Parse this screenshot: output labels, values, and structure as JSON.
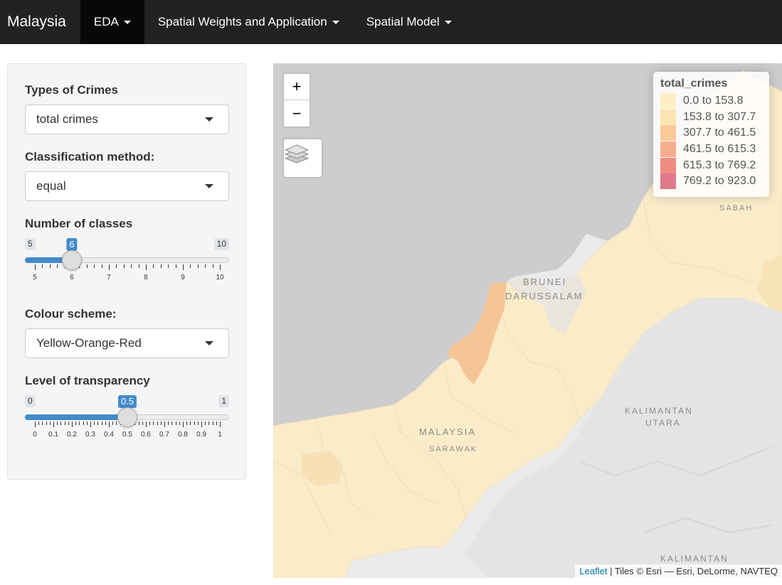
{
  "navbar": {
    "brand": "Malaysia",
    "items": [
      {
        "label": "EDA",
        "active": true
      },
      {
        "label": "Spatial Weights and Application",
        "active": false
      },
      {
        "label": "Spatial Model",
        "active": false
      }
    ]
  },
  "sidebar": {
    "crime_type": {
      "label": "Types of Crimes",
      "value": "total crimes"
    },
    "classification": {
      "label": "Classification method:",
      "value": "equal"
    },
    "num_classes": {
      "label": "Number of classes",
      "min": "5",
      "max": "10",
      "value": 6,
      "ticks": [
        "5",
        "6",
        "7",
        "8",
        "9",
        "10"
      ]
    },
    "colour_scheme": {
      "label": "Colour scheme:",
      "value": "Yellow-Orange-Red"
    },
    "transparency": {
      "label": "Level of transparency",
      "min": "0",
      "max": "1",
      "value": 0.5,
      "ticks": [
        "0",
        "0.1",
        "0.2",
        "0.3",
        "0.4",
        "0.5",
        "0.6",
        "0.7",
        "0.8",
        "0.9",
        "1"
      ]
    }
  },
  "map": {
    "zoom_in": "+",
    "zoom_out": "−",
    "legend": {
      "title": "total_crimes",
      "classes": [
        {
          "label": "0.0 to 153.8",
          "color": "#fcefc6"
        },
        {
          "label": "153.8 to 307.7",
          "color": "#fbe4b3"
        },
        {
          "label": "307.7 to 461.5",
          "color": "#f9c998"
        },
        {
          "label": "461.5 to 615.3",
          "color": "#f6ad8e"
        },
        {
          "label": "615.3 to 769.2",
          "color": "#ef8c82"
        },
        {
          "label": "769.2 to 923.0",
          "color": "#df7a8a"
        }
      ]
    },
    "labels": {
      "sabah": "SABAH",
      "brunei_1": "BRUNEI",
      "brunei_2": "DARUSSALAM",
      "kalimantan_utara_1": "KALIMANTAN",
      "kalimantan_utara_2": "UTARA",
      "malaysia": "MALAYSIA",
      "sarawak": "SARAWAK",
      "kalimantan": "KALIMANTAN"
    },
    "attribution": {
      "link": "Leaflet",
      "text": " | Tiles © Esri — Esri, DeLorme, NAVTEQ"
    }
  }
}
